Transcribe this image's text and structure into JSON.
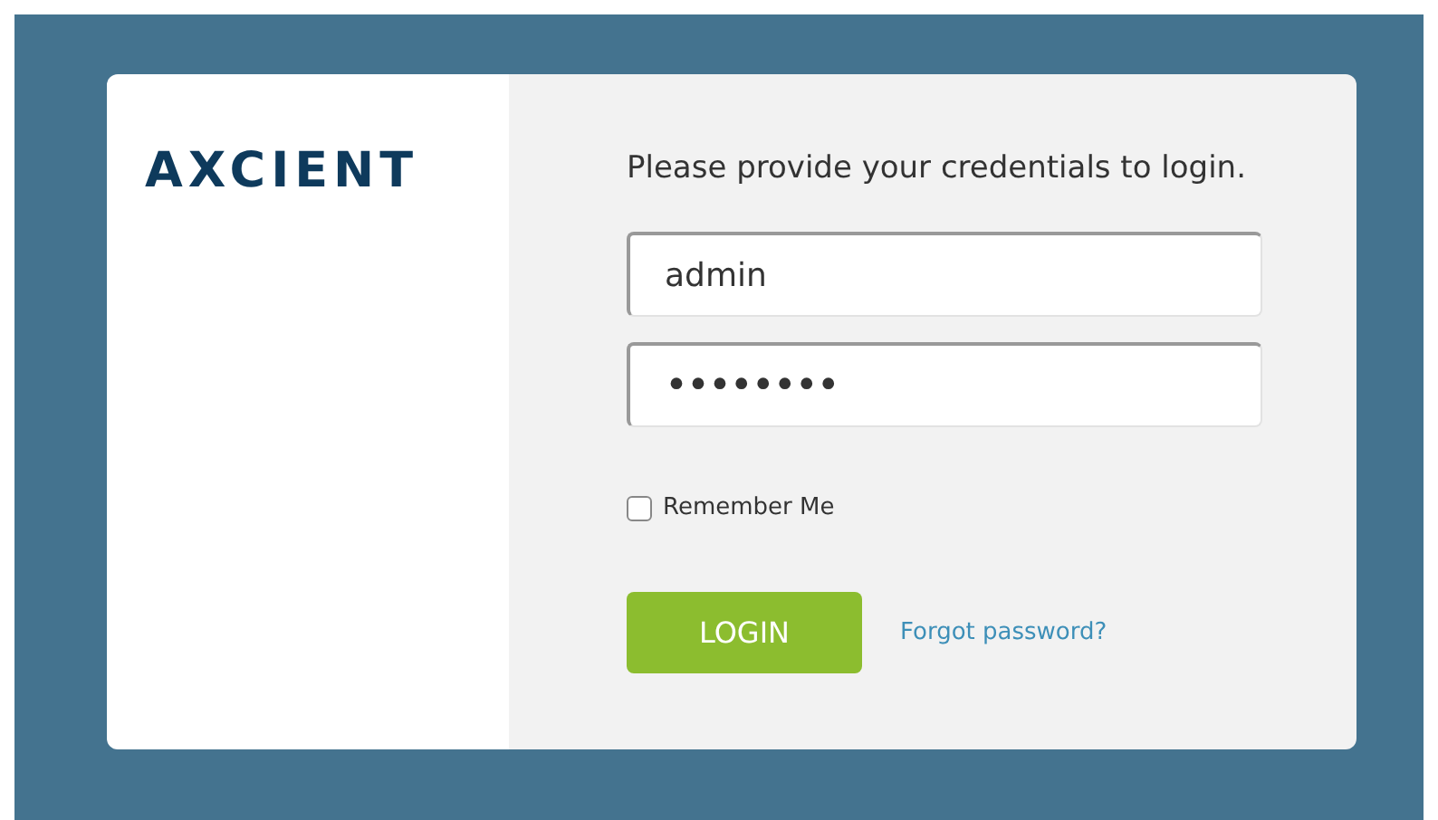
{
  "logo": {
    "text": "AXCIENT"
  },
  "prompt": "Please provide your credentials to login.",
  "fields": [
    {
      "kind": "text",
      "value": "admin"
    },
    {
      "kind": "password",
      "value": "••••••••"
    }
  ],
  "remember": {
    "label": "Remember Me",
    "checked": false
  },
  "login_button": "LOGIN",
  "forgot_link": "Forgot password?"
}
